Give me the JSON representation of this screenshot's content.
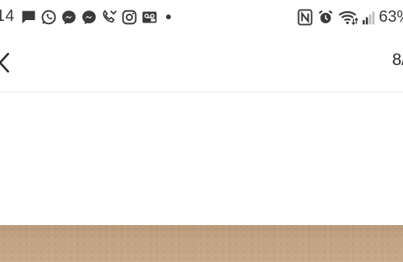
{
  "status_bar": {
    "time": "14",
    "notification_icons": [
      "message-icon",
      "whatsapp-icon",
      "messenger-icon",
      "messenger-icon",
      "missed-call-icon",
      "instagram-icon",
      "voicemail-icon"
    ],
    "system_icons": [
      "nfc-icon",
      "alarm-icon",
      "wifi-icon",
      "signal-icon"
    ],
    "battery": "63%"
  },
  "toolbar": {
    "page_counter": "8/"
  },
  "colors": {
    "icon": "#3a3a3a",
    "divider": "#e8e8e8",
    "photo": "#c2a383"
  }
}
